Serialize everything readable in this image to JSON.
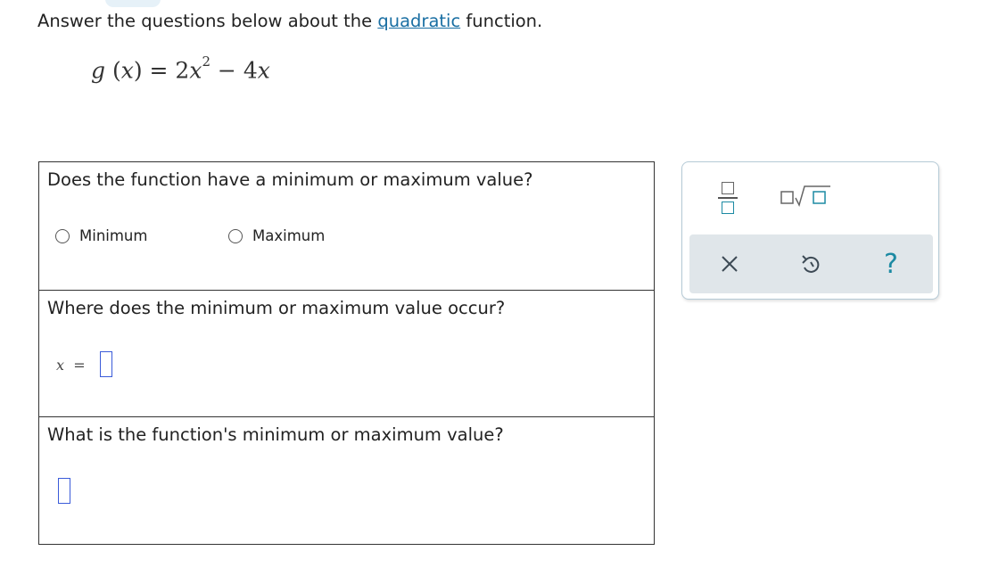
{
  "intro": {
    "before": "Answer the questions below about the ",
    "link": "quadratic",
    "after": " function."
  },
  "equation": {
    "lhs_fn": "g",
    "lhs_open": " (",
    "lhs_var": "x",
    "lhs_close": ") = 2",
    "term1_var": "x",
    "term1_exp": "2",
    "op": " − 4",
    "term2_var": "x"
  },
  "questions": [
    {
      "text": "Does the function have a minimum or maximum value?",
      "options": [
        "Minimum",
        "Maximum"
      ],
      "selected": null
    },
    {
      "text": "Where does the minimum or maximum value occur?",
      "answer_prefix_var": "x",
      "answer_prefix_eq": "=",
      "answer_value": ""
    },
    {
      "text": "What is the function's minimum or maximum value?",
      "answer_value": ""
    }
  ],
  "toolbox": {
    "tools": [
      "fraction-icon",
      "square-root-icon"
    ],
    "actions": [
      "close-icon",
      "undo-icon",
      "help-icon"
    ],
    "help_label": "?",
    "accent_color": "#1c8aa3"
  },
  "colors": {
    "link": "#1a6fa3",
    "answer_box": "#3a5bd9",
    "action_bar": "#e0e6ea"
  }
}
